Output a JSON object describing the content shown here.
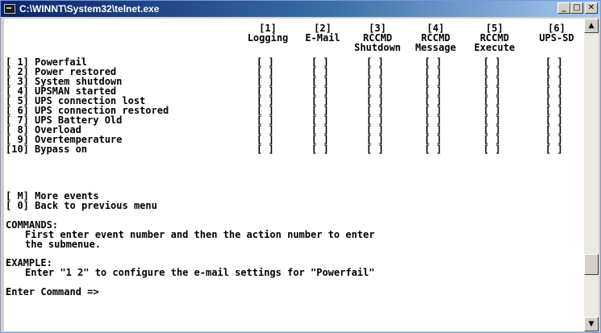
{
  "window": {
    "title": "C:\\WINNT\\System32\\telnet.exe",
    "minimize_label": "_",
    "maximize_label": "□",
    "close_label": "✕"
  },
  "columns": [
    {
      "num": "[1]",
      "line1": "Logging",
      "line2": ""
    },
    {
      "num": "[2]",
      "line1": "E-Mail",
      "line2": ""
    },
    {
      "num": "[3]",
      "line1": "RCCMD",
      "line2": "Shutdown"
    },
    {
      "num": "[4]",
      "line1": "RCCMD",
      "line2": "Message"
    },
    {
      "num": "[5]",
      "line1": "RCCMD",
      "line2": "Execute"
    },
    {
      "num": "[6]",
      "line1": "UPS-SD",
      "line2": ""
    }
  ],
  "checkbox_label": "[ ]",
  "events": [
    {
      "id": "[ 1]",
      "label": "Powerfail"
    },
    {
      "id": "[ 2]",
      "label": "Power restored"
    },
    {
      "id": "[ 3]",
      "label": "System shutdown"
    },
    {
      "id": "[ 4]",
      "label": "UPSMAN started"
    },
    {
      "id": "[ 5]",
      "label": "UPS connection lost"
    },
    {
      "id": "[ 6]",
      "label": "UPS connection restored"
    },
    {
      "id": "[ 7]",
      "label": "UPS Battery Old"
    },
    {
      "id": "[ 8]",
      "label": "Overload"
    },
    {
      "id": "[ 9]",
      "label": "Overtemperature"
    },
    {
      "id": "[10]",
      "label": "Bypass on"
    }
  ],
  "menu": [
    {
      "id": "[ M]",
      "label": "More events"
    },
    {
      "id": "[ 0]",
      "label": "Back to previous menu"
    }
  ],
  "commands": {
    "heading": "COMMANDS:",
    "line1": "First enter event number and then the action number to enter",
    "line2": "the submenue."
  },
  "example": {
    "heading": "EXAMPLE:",
    "line1": "Enter \"1 2\" to configure the e-mail settings for \"Powerfail\""
  },
  "prompt": "Enter Command =>"
}
